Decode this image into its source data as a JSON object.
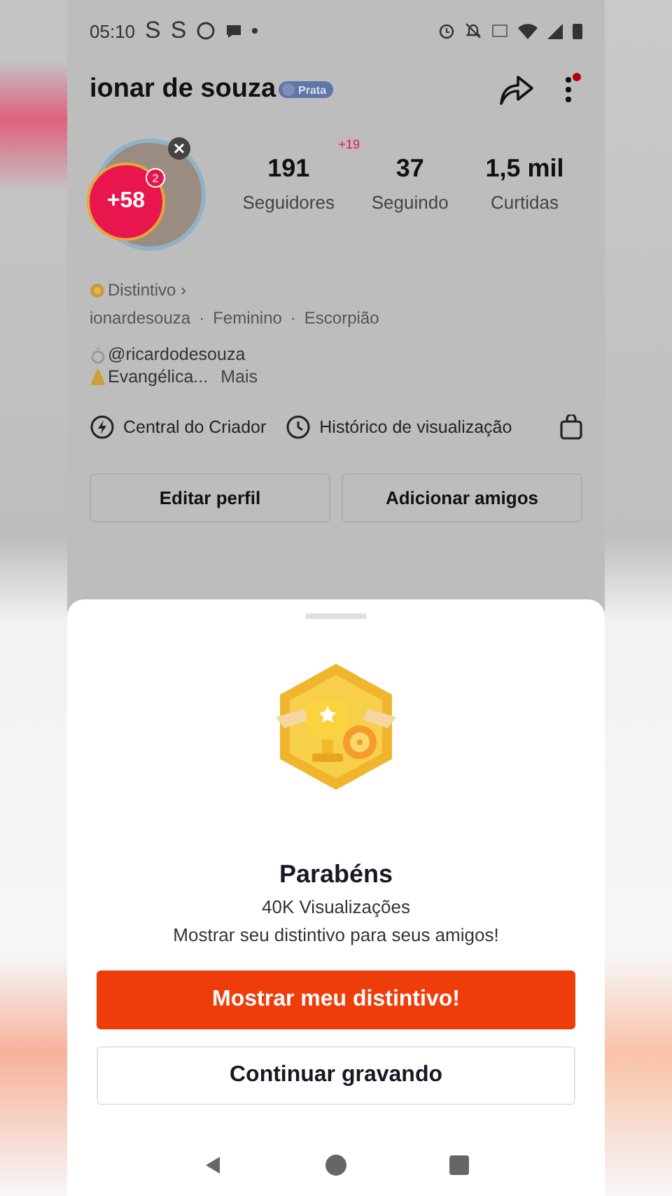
{
  "status_bar": {
    "time": "05:10",
    "app_letters": [
      "S",
      "S"
    ]
  },
  "profile": {
    "name": "ionar de souza",
    "badge": "Prata",
    "avatar_bubble": "+58",
    "avatar_count": "2",
    "stats": [
      {
        "value": "191",
        "label": "Seguidores",
        "delta": "+19"
      },
      {
        "value": "37",
        "label": "Seguindo"
      },
      {
        "value": "1,5 mil",
        "label": "Curtidas"
      }
    ],
    "distinctive": "Distintivo ›",
    "meta": [
      "ionardesouza",
      "Feminino",
      "Escorpião"
    ],
    "meta_separator": "·",
    "bio": [
      {
        "kind": "ring",
        "text": "@ricardodesouza"
      },
      {
        "kind": "pray",
        "text": "Evangélica...",
        "more": "Mais"
      }
    ],
    "shortcuts": [
      {
        "kind": "bolt",
        "label": "Central do Criador"
      },
      {
        "kind": "clock",
        "label": "Histórico de visualização"
      }
    ],
    "buttons": [
      "Editar perfil",
      "Adicionar amigos"
    ]
  },
  "sheet": {
    "title": "Parabéns",
    "subtitle": "40K Visualizações",
    "message": "Mostrar seu distintivo para seus amigos!",
    "primary": "Mostrar meu distintivo!",
    "secondary": "Continuar gravando"
  }
}
